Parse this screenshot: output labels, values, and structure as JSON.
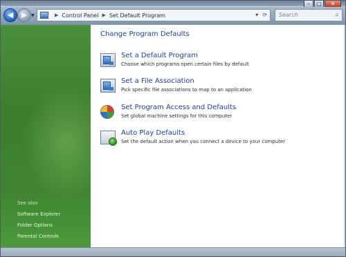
{
  "window": {
    "caption": {
      "minimize": "–",
      "maximize": "□",
      "close": "✕"
    }
  },
  "nav": {
    "back_icon": "arrow-left-icon",
    "forward_icon": "arrow-right-icon",
    "breadcrumb": [
      "Control Panel",
      "Set Default Program"
    ],
    "search_placeholder": "Search"
  },
  "sidebar": {
    "see_also": "See also",
    "links": [
      "Software Explorer",
      "Folder Options",
      "Parental Controls"
    ]
  },
  "main": {
    "title": "Change Program Defaults",
    "tasks": [
      {
        "title": "Set a Default Program",
        "desc": "Choose which programs open certain files by default",
        "icon": "programs-window-icon"
      },
      {
        "title": "Set a File Association",
        "desc": "Pick specific file associations to map to an application",
        "icon": "file-association-icon"
      },
      {
        "title": "Set Program Access and Defaults",
        "desc": "Set global machine settings for this computer",
        "icon": "windows-globe-icon"
      },
      {
        "title": "Auto Play Defaults",
        "desc": "Set the default action when you connect a device to your computer",
        "icon": "autoplay-icon"
      }
    ]
  }
}
